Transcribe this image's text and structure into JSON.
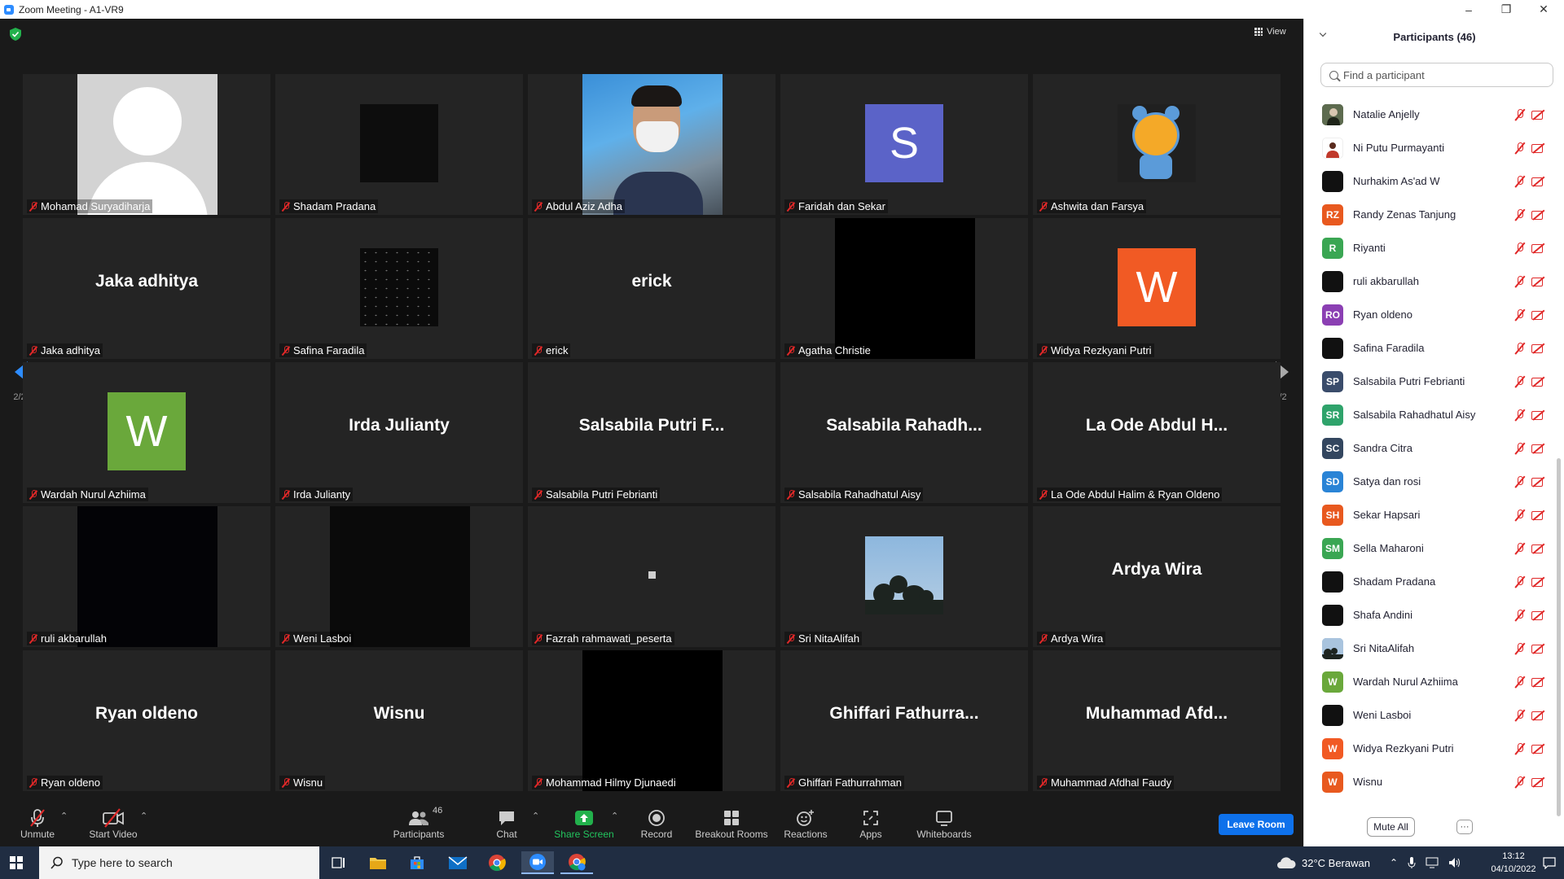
{
  "window": {
    "title": "Zoom Meeting - A1-VR9",
    "minimize": "–",
    "maximize": "❐",
    "close": "✕"
  },
  "meeting": {
    "view_label": "View",
    "page_indicator": "2/2",
    "tiles": [
      {
        "label": "Mohamad Suryadiharja",
        "display": ""
      },
      {
        "label": "Shadam Pradana",
        "display": ""
      },
      {
        "label": "Abdul Aziz Adha",
        "display": ""
      },
      {
        "label": "Faridah dan Sekar",
        "display": "S"
      },
      {
        "label": "Ashwita dan Farsya",
        "display": ""
      },
      {
        "label": "Jaka adhitya",
        "display": "Jaka adhitya"
      },
      {
        "label": "Safina Faradila",
        "display": ""
      },
      {
        "label": "erick",
        "display": "erick"
      },
      {
        "label": "Agatha Christie",
        "display": ""
      },
      {
        "label": "Widya Rezkyani Putri",
        "display": "W"
      },
      {
        "label": "Wardah Nurul Azhiima",
        "display": "W"
      },
      {
        "label": "Irda Julianty",
        "display": "Irda Julianty"
      },
      {
        "label": "Salsabila Putri Febrianti",
        "display": "Salsabila Putri F..."
      },
      {
        "label": "Salsabila Rahadhatul Aisy",
        "display": "Salsabila Rahadh..."
      },
      {
        "label": "La Ode Abdul Halim & Ryan Oldeno",
        "display": "La Ode Abdul H..."
      },
      {
        "label": "ruli akbarullah",
        "display": ""
      },
      {
        "label": "Weni Lasboi",
        "display": ""
      },
      {
        "label": "Fazrah rahmawati_peserta",
        "display": ""
      },
      {
        "label": "Sri NitaAlifah",
        "display": ""
      },
      {
        "label": "Ardya Wira",
        "display": "Ardya Wira"
      },
      {
        "label": "Ryan oldeno",
        "display": "Ryan oldeno"
      },
      {
        "label": "Wisnu",
        "display": "Wisnu"
      },
      {
        "label": "Mohammad Hilmy Djunaedi",
        "display": ""
      },
      {
        "label": "Ghiffari Fathurrahman",
        "display": "Ghiffari Fathurra..."
      },
      {
        "label": "Muhammad Afdhal Faudy",
        "display": "Muhammad Afd..."
      }
    ],
    "colors": {
      "letter_s": "#5b63c8",
      "letter_w_orange": "#f15a24",
      "letter_w_green": "#6aa83b",
      "accent": "#2d8cff",
      "muted_red": "#e02828"
    }
  },
  "toolbar": {
    "unmute": "Unmute",
    "start_video": "Start Video",
    "participants": "Participants",
    "participants_count": "46",
    "chat": "Chat",
    "share_screen": "Share Screen",
    "record": "Record",
    "breakout_rooms": "Breakout Rooms",
    "reactions": "Reactions",
    "apps": "Apps",
    "whiteboards": "Whiteboards",
    "leave": "Leave Room"
  },
  "panel": {
    "title": "Participants (46)",
    "search_placeholder": "Find a participant",
    "mute_all": "Mute All",
    "more": "···",
    "participants": [
      {
        "name": "Natalie Anjelly",
        "initials": "",
        "color": "#2f3b2a",
        "kind": "photo"
      },
      {
        "name": "Ni Putu Purmayanti",
        "initials": "",
        "color": "#ffffff",
        "kind": "person"
      },
      {
        "name": "Nurhakim As'ad W",
        "initials": "",
        "color": "#111111",
        "kind": "dark"
      },
      {
        "name": "Randy Zenas Tanjung",
        "initials": "RZ",
        "color": "#e8591f",
        "kind": "letters"
      },
      {
        "name": "Riyanti",
        "initials": "R",
        "color": "#3aa653",
        "kind": "letters"
      },
      {
        "name": "ruli akbarullah",
        "initials": "",
        "color": "#111111",
        "kind": "dark"
      },
      {
        "name": "Ryan oldeno",
        "initials": "RO",
        "color": "#8b3fb3",
        "kind": "letters"
      },
      {
        "name": "Safina Faradila",
        "initials": "",
        "color": "#111111",
        "kind": "dark"
      },
      {
        "name": "Salsabila Putri Febrianti",
        "initials": "SP",
        "color": "#3a4c6b",
        "kind": "letters"
      },
      {
        "name": "Salsabila Rahadhatul Aisy",
        "initials": "SR",
        "color": "#2fa36b",
        "kind": "letters"
      },
      {
        "name": "Sandra Citra",
        "initials": "SC",
        "color": "#33465f",
        "kind": "letters"
      },
      {
        "name": "Satya dan rosi",
        "initials": "SD",
        "color": "#2a84d6",
        "kind": "letters"
      },
      {
        "name": "Sekar Hapsari",
        "initials": "SH",
        "color": "#e8591f",
        "kind": "letters"
      },
      {
        "name": "Sella Maharoni",
        "initials": "SM",
        "color": "#3aa653",
        "kind": "letters"
      },
      {
        "name": "Shadam Pradana",
        "initials": "",
        "color": "#111111",
        "kind": "dark"
      },
      {
        "name": "Shafa Andini",
        "initials": "",
        "color": "#111111",
        "kind": "dark"
      },
      {
        "name": "Sri NitaAlifah",
        "initials": "",
        "color": "#7e9bb8",
        "kind": "sky"
      },
      {
        "name": "Wardah Nurul Azhiima",
        "initials": "W",
        "color": "#6aa83b",
        "kind": "letters"
      },
      {
        "name": "Weni Lasboi",
        "initials": "",
        "color": "#111111",
        "kind": "dark"
      },
      {
        "name": "Widya Rezkyani Putri",
        "initials": "W",
        "color": "#f15a24",
        "kind": "letters"
      },
      {
        "name": "Wisnu",
        "initials": "W",
        "color": "#e8591f",
        "kind": "letters"
      }
    ]
  },
  "taskbar": {
    "search_placeholder": "Type here to search",
    "weather": "32°C  Berawan",
    "time": "13:12",
    "date": "04/10/2022"
  }
}
